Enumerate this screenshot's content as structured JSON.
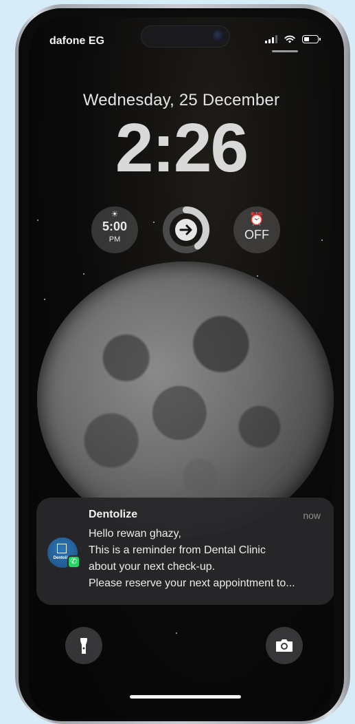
{
  "status_bar": {
    "carrier": "dafone EG",
    "icons": [
      "signal-icon",
      "wifi-icon",
      "battery-icon"
    ]
  },
  "lock_screen": {
    "date": "Wednesday, 25 December",
    "time": "2:26"
  },
  "widgets": {
    "sunset": {
      "icon": "sunset-icon",
      "value": "5:00",
      "unit": "PM"
    },
    "activity_ring": {
      "icon": "arrow-right-icon",
      "progress": 0.4
    },
    "alarm": {
      "icon": "alarm-clock-icon",
      "value": "OFF"
    }
  },
  "wallpaper": {
    "subject": "moon-image"
  },
  "notification": {
    "app_name": "Dentolize",
    "time": "now",
    "app_icon": "dentolize-logo",
    "app_icon_text": "Dentolize",
    "badge_icon": "whatsapp-icon",
    "lines": [
      "Hello rewan ghazy,",
      "This is a reminder from Dental Clinic",
      "about your next check-up.",
      "Please reserve your next appointment to..."
    ]
  },
  "quick_actions": {
    "left": "flashlight-icon",
    "right": "camera-icon"
  },
  "colors": {
    "background": "#d6ecf8",
    "notification_bg": "#28282a",
    "whatsapp_green": "#25d366",
    "brand_blue": "#2f77b4"
  }
}
